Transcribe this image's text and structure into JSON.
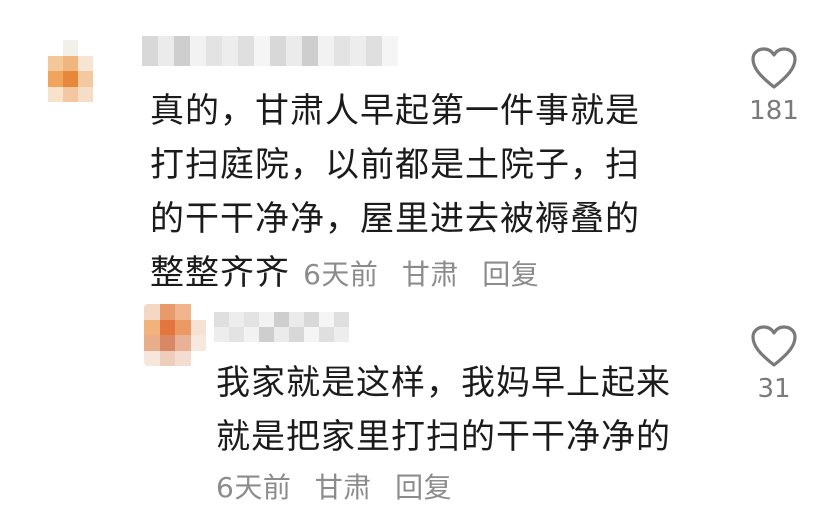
{
  "comments": [
    {
      "lines": [
        "真的，甘肃人早起第一件事就是",
        "打扫庭院，以前都是土院子，扫",
        "的干干净净，屋里进去被褥叠的",
        "整整齐齐"
      ],
      "time": "6天前",
      "location": "甘肃",
      "reply_label": "回复",
      "likes": "181"
    },
    {
      "lines": [
        "我家就是这样，我妈早上起来",
        "就是把家里打扫的干干净净的"
      ],
      "time": "6天前",
      "location": "甘肃",
      "reply_label": "回复",
      "likes": "31"
    }
  ],
  "icons": {
    "like": "heart-outline-icon"
  },
  "colors": {
    "text": "#1b1b1b",
    "meta": "#8c8c8c",
    "heart": "#7a7a7a"
  }
}
